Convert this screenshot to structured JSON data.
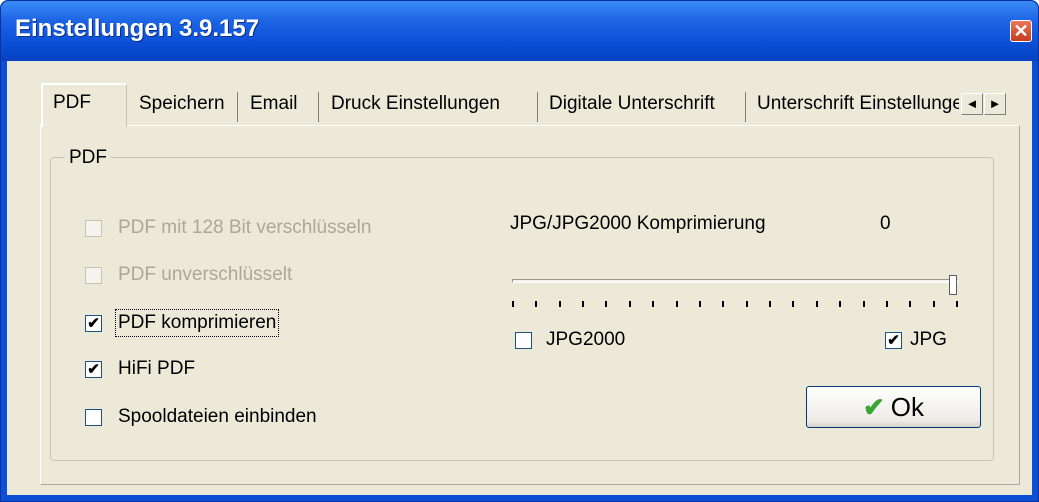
{
  "window": {
    "title": "Einstellungen 3.9.157",
    "close_glyph": "✕"
  },
  "tabs": [
    {
      "label": "PDF",
      "active": true
    },
    {
      "label": "Speichern"
    },
    {
      "label": "Email"
    },
    {
      "label": "Druck Einstellungen"
    },
    {
      "label": "Digitale Unterschrift"
    },
    {
      "label": "Unterschrift Einstellungen"
    }
  ],
  "tab_scroll": {
    "left": "◄",
    "right": "►"
  },
  "group": {
    "label": "PDF"
  },
  "options": [
    {
      "label": "PDF mit 128 Bit verschlüsseln",
      "checked": false,
      "enabled": false,
      "mark": ""
    },
    {
      "label": "PDF unverschlüsselt",
      "checked": false,
      "enabled": false,
      "mark": ""
    },
    {
      "label": "PDF komprimieren",
      "checked": true,
      "enabled": true,
      "mark": "✔"
    },
    {
      "label": "HiFi PDF",
      "checked": true,
      "enabled": true,
      "mark": "✔"
    },
    {
      "label": "Spooldateien einbinden",
      "checked": false,
      "enabled": true,
      "mark": ""
    }
  ],
  "compression": {
    "label": "JPG/JPG2000 Komprimierung",
    "value": "0",
    "slider_position": 1.0,
    "jpg2000": {
      "label": "JPG2000",
      "checked": false,
      "mark": ""
    },
    "jpg": {
      "label": "JPG",
      "checked": true,
      "mark": "✔"
    }
  },
  "ok_button": {
    "label": "Ok",
    "icon": "checkmark-icon",
    "icon_glyph": "✔"
  },
  "colors": {
    "title_bar": "#0a4fd6",
    "face": "#ece9d8",
    "ok_icon": "#3aa635"
  }
}
